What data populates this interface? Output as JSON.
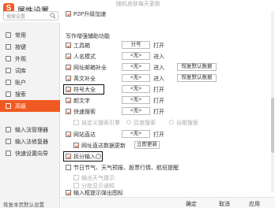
{
  "window": {
    "title": "属性设置",
    "logo_letter": "S"
  },
  "search": {
    "placeholder": "搜索设置"
  },
  "sidebar": {
    "items": [
      {
        "label": "常用"
      },
      {
        "label": "按键"
      },
      {
        "label": "外观"
      },
      {
        "label": "词库"
      },
      {
        "label": "账户"
      },
      {
        "label": "搜索"
      },
      {
        "label": "高级"
      },
      {
        "label": "输入法管理器"
      },
      {
        "label": "输入法修复器"
      },
      {
        "label": "快速设置向导"
      }
    ],
    "active_index": 6,
    "restore_label": "恢复本页默认设置"
  },
  "top": {
    "p2p_label": "P2P升级加速",
    "faded_top": "随机皮肤每天更新"
  },
  "section": {
    "title": "写作增强辅助功能"
  },
  "rows": [
    {
      "label": "工具箱",
      "value": "分号",
      "link": "打开"
    },
    {
      "label": "人名模式",
      "value": "<无>",
      "link": "进入"
    },
    {
      "label": "网址邮箱补全",
      "value": "<无>",
      "link": "进入",
      "action": "恢复默认数据"
    },
    {
      "label": "英文补全",
      "value": "<无>",
      "link": "进入",
      "action": "恢复默认数据"
    },
    {
      "label": "符号大全",
      "value": "<无>",
      "link": "打开"
    },
    {
      "label": "颜文字",
      "value": "<无>",
      "link": "打开"
    },
    {
      "label": "快速搜索",
      "value": "<无>",
      "link": "打开"
    }
  ],
  "engine": {
    "label": "自定义搜索引擎",
    "opt1": "百度搜索",
    "opt2": "谷歌搜索"
  },
  "direct": {
    "label": "网站直达",
    "value": "<无>",
    "link": "打开",
    "sub_label": "网址直达数据更新",
    "update_btn": "立即更新"
  },
  "split": {
    "label": "拆分输入"
  },
  "holiday": {
    "label": "节日节气、天气预报、股票行情、航班提醒"
  },
  "faded_mid": "输出天气提示",
  "faded_low": "分批显示通知",
  "hint": {
    "label": "输入框提示弹出图标"
  },
  "footer": {
    "ok": "确定",
    "cancel": "取消",
    "apply": "应用"
  },
  "colors": {
    "accent": "#f05a22",
    "sidebar_bg": "#f3f3f3"
  }
}
